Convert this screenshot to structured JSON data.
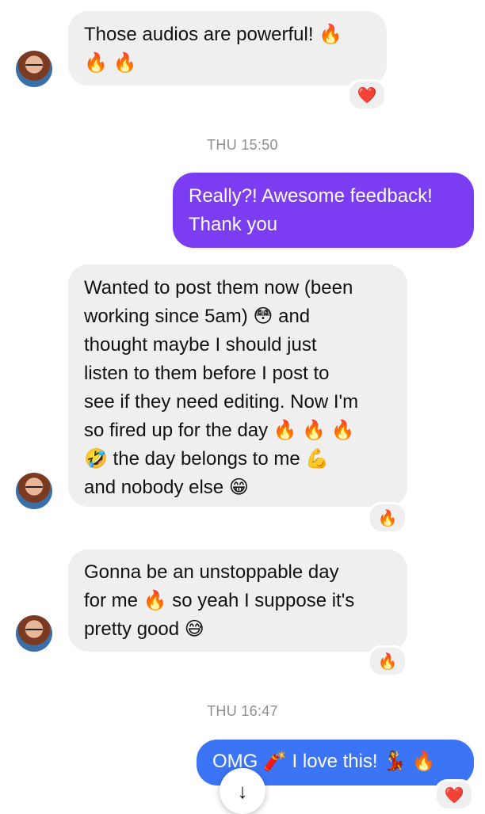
{
  "messages": [
    {
      "text": "Those audios are powerful! 🔥\n🔥 🔥",
      "reaction": "❤️"
    },
    {
      "timestamp": "THU 15:50"
    },
    {
      "text": "Really?! Awesome feedback!\nThank you"
    },
    {
      "text": "Wanted to post them now (been\nworking since 5am) 😳 and\nthought maybe I should just\nlisten to them before I post to\nsee if they need editing. Now I'm\nso fired up for the day 🔥 🔥 🔥\n🤣 the day belongs to me 💪\nand nobody else 😁",
      "reaction": "🔥"
    },
    {
      "text": "Gonna be an unstoppable day\nfor me 🔥 so yeah I suppose it's\npretty good 😅",
      "reaction": "🔥"
    },
    {
      "timestamp": "THU 16:47"
    },
    {
      "text": "OMG 🧨 I love this! 💃 🔥",
      "reaction": "❤️"
    }
  ],
  "scroll_button": "↓"
}
